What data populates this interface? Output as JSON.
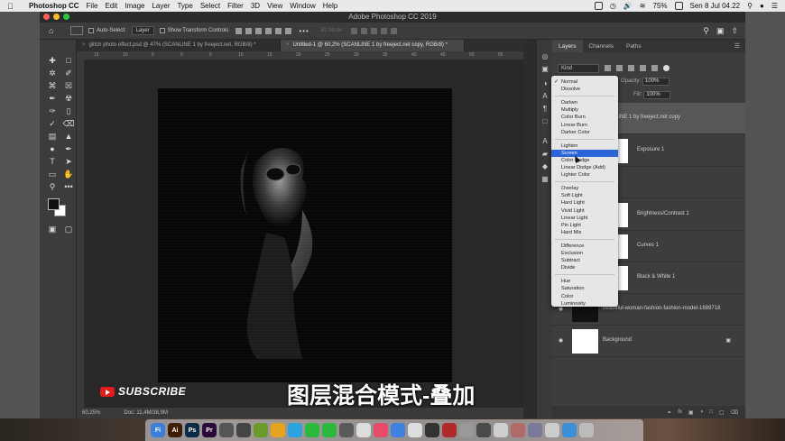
{
  "menubar": {
    "app_name": "Photoshop CC",
    "items": [
      "File",
      "Edit",
      "Image",
      "Layer",
      "Type",
      "Select",
      "Filter",
      "3D",
      "View",
      "Window",
      "Help"
    ],
    "battery": "75%",
    "clock": "Sen 8 Jul 04.22"
  },
  "window": {
    "title": "Adobe Photoshop CC 2019"
  },
  "options": {
    "auto_select_label": "Auto-Select:",
    "auto_select_value": "Layer",
    "transform_label": "Show Transform Controls",
    "mode_3d": "3D Mode:"
  },
  "tabs": [
    {
      "label": "glitch photo effect.psd @ 47% (SCANLINE 1 by freeject.net, RGB/8) *"
    },
    {
      "label": "Untitled-1 @ 60,2% (SCANLINE 1 by freeject.net copy, RGB/8) *"
    }
  ],
  "ruler": {
    "h_ticks": [
      "15",
      "10",
      "5",
      "0",
      "5",
      "10",
      "15",
      "20",
      "25",
      "30",
      "35",
      "40",
      "45",
      "50",
      "55"
    ]
  },
  "status": {
    "zoom": "60,25%",
    "doc": "Doc: 11,4M/38,9M"
  },
  "layers_panel": {
    "tabs": [
      "Layers",
      "Channels",
      "Paths"
    ],
    "kind": "Kind",
    "opacity_label": "Opacity:",
    "opacity_value": "100%",
    "fill_label": "Fill:",
    "fill_value": "100%",
    "layers": [
      {
        "name": "LINE 1 by freeject.net copy"
      },
      {
        "name": "Exposure 1"
      },
      {
        "name": "Brightness/Contrast 1"
      },
      {
        "name": "Curves 1"
      },
      {
        "name": "Black & White 1"
      },
      {
        "name": "beautiful-woman-fashion-fashion-model-1689718"
      },
      {
        "name": "Background"
      }
    ]
  },
  "blend_menu": {
    "groups": [
      [
        "Normal",
        "Dissolve"
      ],
      [
        "Darken",
        "Multiply",
        "Color Burn",
        "Linear Burn",
        "Darker Color"
      ],
      [
        "Lighten",
        "Screen",
        "Color Dodge",
        "Linear Dodge (Add)",
        "Lighter Color"
      ],
      [
        "Overlay",
        "Soft Light",
        "Hard Light",
        "Vivid Light",
        "Linear Light",
        "Pin Light",
        "Hard Mix"
      ],
      [
        "Difference",
        "Exclusion",
        "Subtract",
        "Divide"
      ],
      [
        "Hue",
        "Saturation",
        "Color",
        "Luminosity"
      ]
    ],
    "checked": "Normal",
    "highlighted": "Screen"
  },
  "overlay": {
    "subscribe": "SUBSCRIBE",
    "caption": "图层混合模式-叠加"
  },
  "dock_apps": [
    {
      "label": "Fi",
      "color": "#3b7fd6"
    },
    {
      "label": "Ai",
      "color": "#3d1f04"
    },
    {
      "label": "Ps",
      "color": "#0a2a45"
    },
    {
      "label": "Pr",
      "color": "#2a0a3a"
    },
    {
      "label": "",
      "color": "#555555"
    },
    {
      "label": "",
      "color": "#444444"
    },
    {
      "label": "",
      "color": "#6b9a2a"
    },
    {
      "label": "",
      "color": "#e5a51e"
    },
    {
      "label": "",
      "color": "#2aa3e0"
    },
    {
      "label": "",
      "color": "#2cba3c"
    },
    {
      "label": "",
      "color": "#2cba3c"
    },
    {
      "label": "",
      "color": "#5a5a5a"
    },
    {
      "label": "",
      "color": "#dddddd"
    },
    {
      "label": "",
      "color": "#e84a6a"
    },
    {
      "label": "",
      "color": "#4080e0"
    },
    {
      "label": "",
      "color": "#dddddd"
    },
    {
      "label": "",
      "color": "#333333"
    },
    {
      "label": "",
      "color": "#b02a2a"
    },
    {
      "label": "",
      "color": "#999999"
    },
    {
      "label": "",
      "color": "#4a4a4a"
    },
    {
      "label": "",
      "color": "#cfcfcf"
    },
    {
      "label": "",
      "color": "#b06a6a"
    },
    {
      "label": "",
      "color": "#7a7a9a"
    },
    {
      "label": "",
      "color": "#cccccc"
    },
    {
      "label": "",
      "color": "#3b8fd6"
    },
    {
      "label": "",
      "color": "#bbbbbb"
    }
  ]
}
